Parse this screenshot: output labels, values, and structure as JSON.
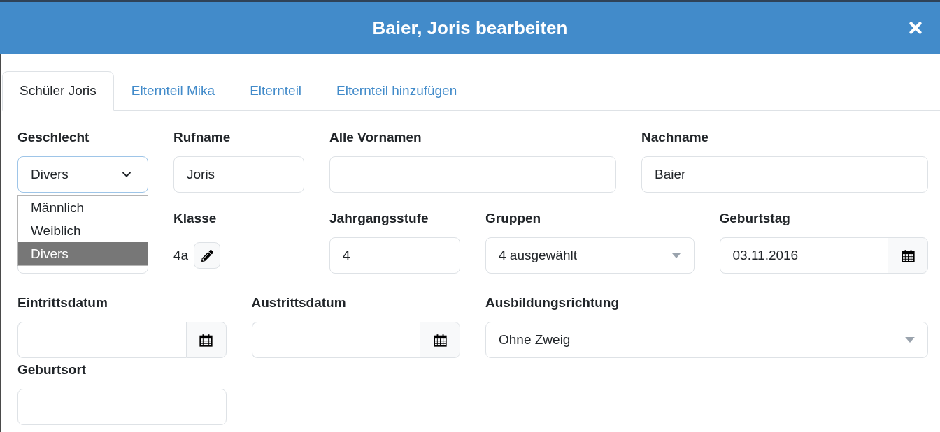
{
  "dialog": {
    "title": "Baier, Joris bearbeiten"
  },
  "tabs": [
    {
      "label": "Schüler Joris",
      "selected": true
    },
    {
      "label": "Elternteil Mika",
      "selected": false
    },
    {
      "label": "Elternteil",
      "selected": false
    },
    {
      "label": "Elternteil hinzufügen",
      "selected": false
    }
  ],
  "form_rows": [
    [
      {
        "kind": "select",
        "label": "Geschlecht",
        "value": "Divers",
        "open": true,
        "options": [
          {
            "label": "Männlich",
            "selected": false
          },
          {
            "label": "Weiblich",
            "selected": false
          },
          {
            "label": "Divers",
            "selected": true
          }
        ]
      },
      {
        "kind": "text",
        "label": "Rufname",
        "value": "Joris"
      },
      {
        "kind": "text",
        "label": "Alle Vornamen"
      },
      {
        "kind": "text",
        "label": "Nachname",
        "value": "Baier"
      }
    ],
    [
      {
        "kind": "text"
      },
      {
        "kind": "class",
        "label": "Klasse",
        "value": "4a"
      },
      {
        "kind": "text",
        "label": "Jahrgangsstufe",
        "value": "4"
      },
      {
        "kind": "combo",
        "label": "Gruppen",
        "value": "4 ausgewählt"
      },
      {
        "kind": "date",
        "label": "Geburtstag",
        "value": "03.11.2016"
      }
    ],
    [
      {
        "kind": "date",
        "label": "Eintrittsdatum"
      },
      {
        "kind": "date",
        "label": "Austrittsdatum"
      },
      {
        "kind": "combo",
        "label": "Ausbildungsrichtung",
        "value": "Ohne Zweig"
      }
    ],
    [
      {
        "kind": "text",
        "label": "Geburtsort"
      }
    ]
  ]
}
